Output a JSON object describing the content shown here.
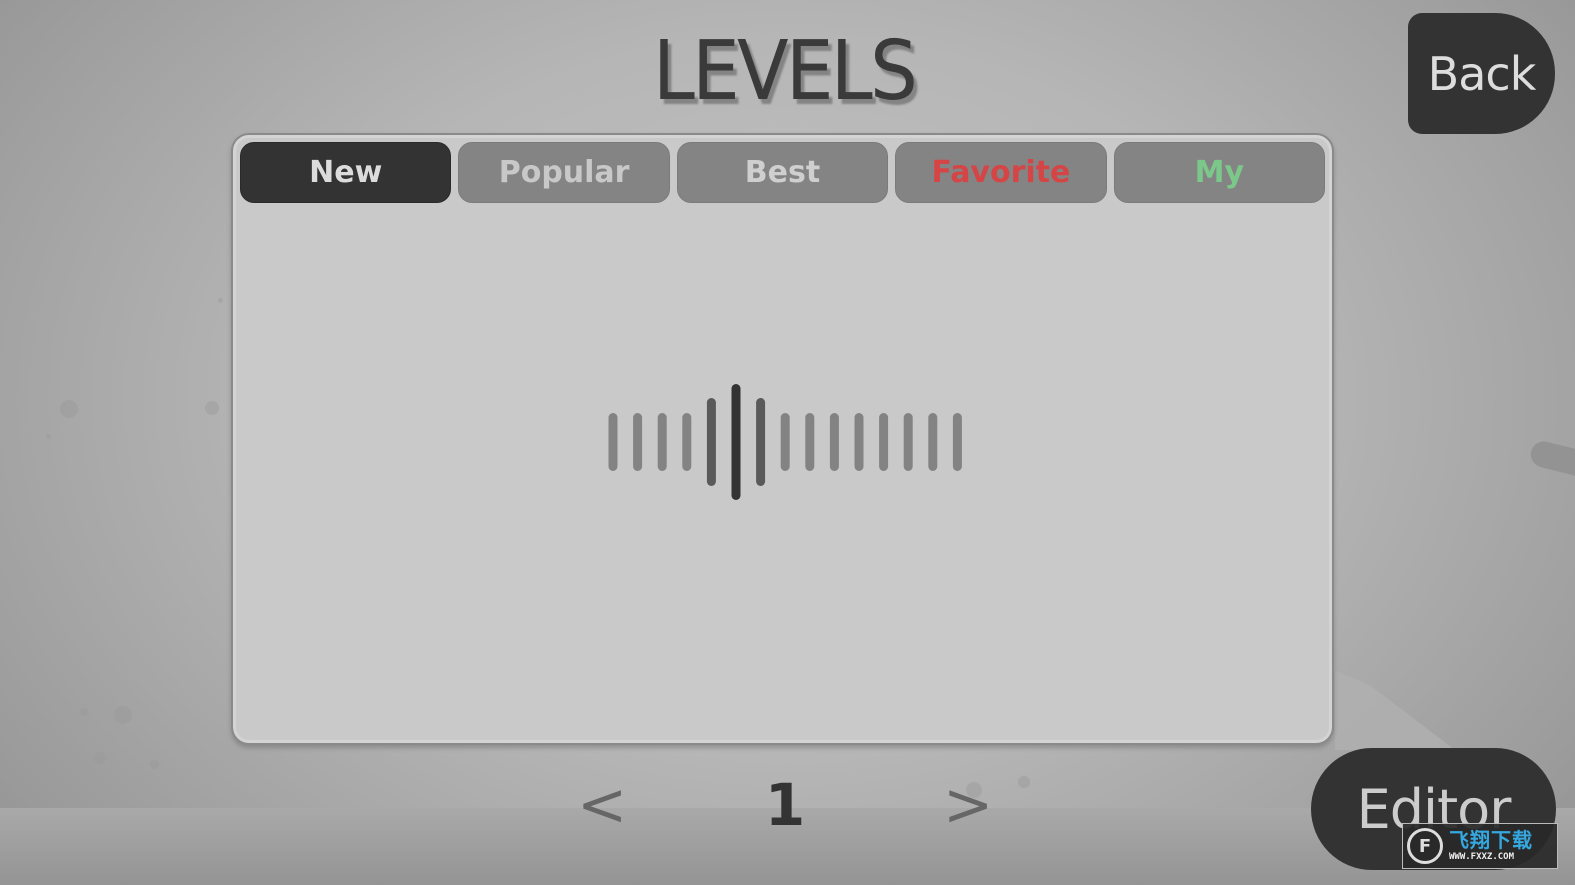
{
  "screen": {
    "title": "LEVELS",
    "back_label": "Back",
    "editor_label": "Editor"
  },
  "tabs": [
    {
      "label": "New",
      "active": true,
      "color": "#dcdcdc"
    },
    {
      "label": "Popular",
      "active": false,
      "color": "#c8c8c8"
    },
    {
      "label": "Best",
      "active": false,
      "color": "#cfcfcf"
    },
    {
      "label": "Favorite",
      "active": false,
      "color": "#d64545"
    },
    {
      "label": "My",
      "active": false,
      "color": "#7cc88a"
    }
  ],
  "loader": {
    "icon": "loading-waveform-icon",
    "bar_count": 15,
    "highlight_index": 5
  },
  "pager": {
    "prev_label": "<",
    "page": "1",
    "next_label": ">"
  },
  "watermark": {
    "logo": "F",
    "brand": "飞翔下载",
    "url": "WWW.FXXZ.COM"
  },
  "colors": {
    "button_dark": "#333333",
    "panel": "#c9c9c9",
    "tab_inactive": "#848484"
  }
}
